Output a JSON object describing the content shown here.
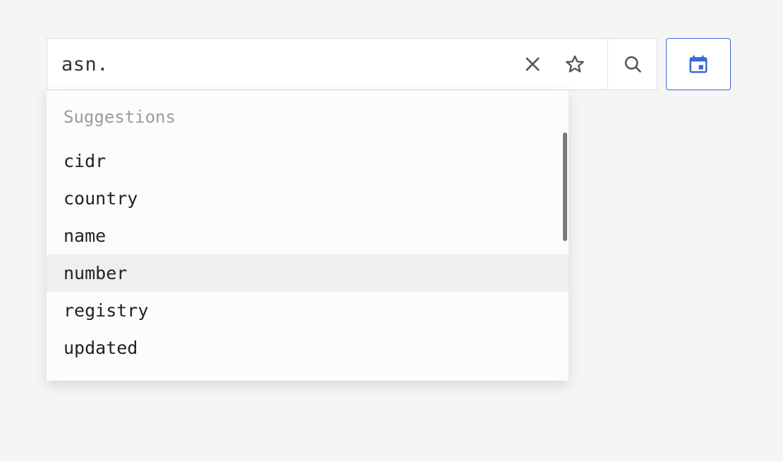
{
  "search": {
    "value": "asn.",
    "placeholder": ""
  },
  "icons": {
    "clear": "close-icon",
    "star": "star-icon",
    "search": "search-icon",
    "date": "calendar-icon"
  },
  "dropdown": {
    "header": "Suggestions",
    "items": [
      {
        "label": "cidr",
        "highlighted": false
      },
      {
        "label": "country",
        "highlighted": false
      },
      {
        "label": "name",
        "highlighted": false
      },
      {
        "label": "number",
        "highlighted": true
      },
      {
        "label": "registry",
        "highlighted": false
      },
      {
        "label": "updated",
        "highlighted": false
      }
    ]
  }
}
